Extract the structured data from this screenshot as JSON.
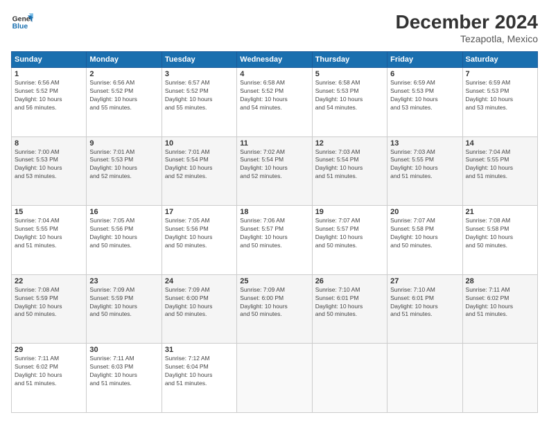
{
  "logo": {
    "line1": "General",
    "line2": "Blue"
  },
  "title": "December 2024",
  "subtitle": "Tezapotla, Mexico",
  "days_header": [
    "Sunday",
    "Monday",
    "Tuesday",
    "Wednesday",
    "Thursday",
    "Friday",
    "Saturday"
  ],
  "weeks": [
    [
      {
        "day": "1",
        "info": "Sunrise: 6:56 AM\nSunset: 5:52 PM\nDaylight: 10 hours\nand 56 minutes."
      },
      {
        "day": "2",
        "info": "Sunrise: 6:56 AM\nSunset: 5:52 PM\nDaylight: 10 hours\nand 55 minutes."
      },
      {
        "day": "3",
        "info": "Sunrise: 6:57 AM\nSunset: 5:52 PM\nDaylight: 10 hours\nand 55 minutes."
      },
      {
        "day": "4",
        "info": "Sunrise: 6:58 AM\nSunset: 5:52 PM\nDaylight: 10 hours\nand 54 minutes."
      },
      {
        "day": "5",
        "info": "Sunrise: 6:58 AM\nSunset: 5:53 PM\nDaylight: 10 hours\nand 54 minutes."
      },
      {
        "day": "6",
        "info": "Sunrise: 6:59 AM\nSunset: 5:53 PM\nDaylight: 10 hours\nand 53 minutes."
      },
      {
        "day": "7",
        "info": "Sunrise: 6:59 AM\nSunset: 5:53 PM\nDaylight: 10 hours\nand 53 minutes."
      }
    ],
    [
      {
        "day": "8",
        "info": "Sunrise: 7:00 AM\nSunset: 5:53 PM\nDaylight: 10 hours\nand 53 minutes."
      },
      {
        "day": "9",
        "info": "Sunrise: 7:01 AM\nSunset: 5:53 PM\nDaylight: 10 hours\nand 52 minutes."
      },
      {
        "day": "10",
        "info": "Sunrise: 7:01 AM\nSunset: 5:54 PM\nDaylight: 10 hours\nand 52 minutes."
      },
      {
        "day": "11",
        "info": "Sunrise: 7:02 AM\nSunset: 5:54 PM\nDaylight: 10 hours\nand 52 minutes."
      },
      {
        "day": "12",
        "info": "Sunrise: 7:03 AM\nSunset: 5:54 PM\nDaylight: 10 hours\nand 51 minutes."
      },
      {
        "day": "13",
        "info": "Sunrise: 7:03 AM\nSunset: 5:55 PM\nDaylight: 10 hours\nand 51 minutes."
      },
      {
        "day": "14",
        "info": "Sunrise: 7:04 AM\nSunset: 5:55 PM\nDaylight: 10 hours\nand 51 minutes."
      }
    ],
    [
      {
        "day": "15",
        "info": "Sunrise: 7:04 AM\nSunset: 5:55 PM\nDaylight: 10 hours\nand 51 minutes."
      },
      {
        "day": "16",
        "info": "Sunrise: 7:05 AM\nSunset: 5:56 PM\nDaylight: 10 hours\nand 50 minutes."
      },
      {
        "day": "17",
        "info": "Sunrise: 7:05 AM\nSunset: 5:56 PM\nDaylight: 10 hours\nand 50 minutes."
      },
      {
        "day": "18",
        "info": "Sunrise: 7:06 AM\nSunset: 5:57 PM\nDaylight: 10 hours\nand 50 minutes."
      },
      {
        "day": "19",
        "info": "Sunrise: 7:07 AM\nSunset: 5:57 PM\nDaylight: 10 hours\nand 50 minutes."
      },
      {
        "day": "20",
        "info": "Sunrise: 7:07 AM\nSunset: 5:58 PM\nDaylight: 10 hours\nand 50 minutes."
      },
      {
        "day": "21",
        "info": "Sunrise: 7:08 AM\nSunset: 5:58 PM\nDaylight: 10 hours\nand 50 minutes."
      }
    ],
    [
      {
        "day": "22",
        "info": "Sunrise: 7:08 AM\nSunset: 5:59 PM\nDaylight: 10 hours\nand 50 minutes."
      },
      {
        "day": "23",
        "info": "Sunrise: 7:09 AM\nSunset: 5:59 PM\nDaylight: 10 hours\nand 50 minutes."
      },
      {
        "day": "24",
        "info": "Sunrise: 7:09 AM\nSunset: 6:00 PM\nDaylight: 10 hours\nand 50 minutes."
      },
      {
        "day": "25",
        "info": "Sunrise: 7:09 AM\nSunset: 6:00 PM\nDaylight: 10 hours\nand 50 minutes."
      },
      {
        "day": "26",
        "info": "Sunrise: 7:10 AM\nSunset: 6:01 PM\nDaylight: 10 hours\nand 50 minutes."
      },
      {
        "day": "27",
        "info": "Sunrise: 7:10 AM\nSunset: 6:01 PM\nDaylight: 10 hours\nand 51 minutes."
      },
      {
        "day": "28",
        "info": "Sunrise: 7:11 AM\nSunset: 6:02 PM\nDaylight: 10 hours\nand 51 minutes."
      }
    ],
    [
      {
        "day": "29",
        "info": "Sunrise: 7:11 AM\nSunset: 6:02 PM\nDaylight: 10 hours\nand 51 minutes."
      },
      {
        "day": "30",
        "info": "Sunrise: 7:11 AM\nSunset: 6:03 PM\nDaylight: 10 hours\nand 51 minutes."
      },
      {
        "day": "31",
        "info": "Sunrise: 7:12 AM\nSunset: 6:04 PM\nDaylight: 10 hours\nand 51 minutes."
      },
      {
        "day": "",
        "info": ""
      },
      {
        "day": "",
        "info": ""
      },
      {
        "day": "",
        "info": ""
      },
      {
        "day": "",
        "info": ""
      }
    ]
  ]
}
